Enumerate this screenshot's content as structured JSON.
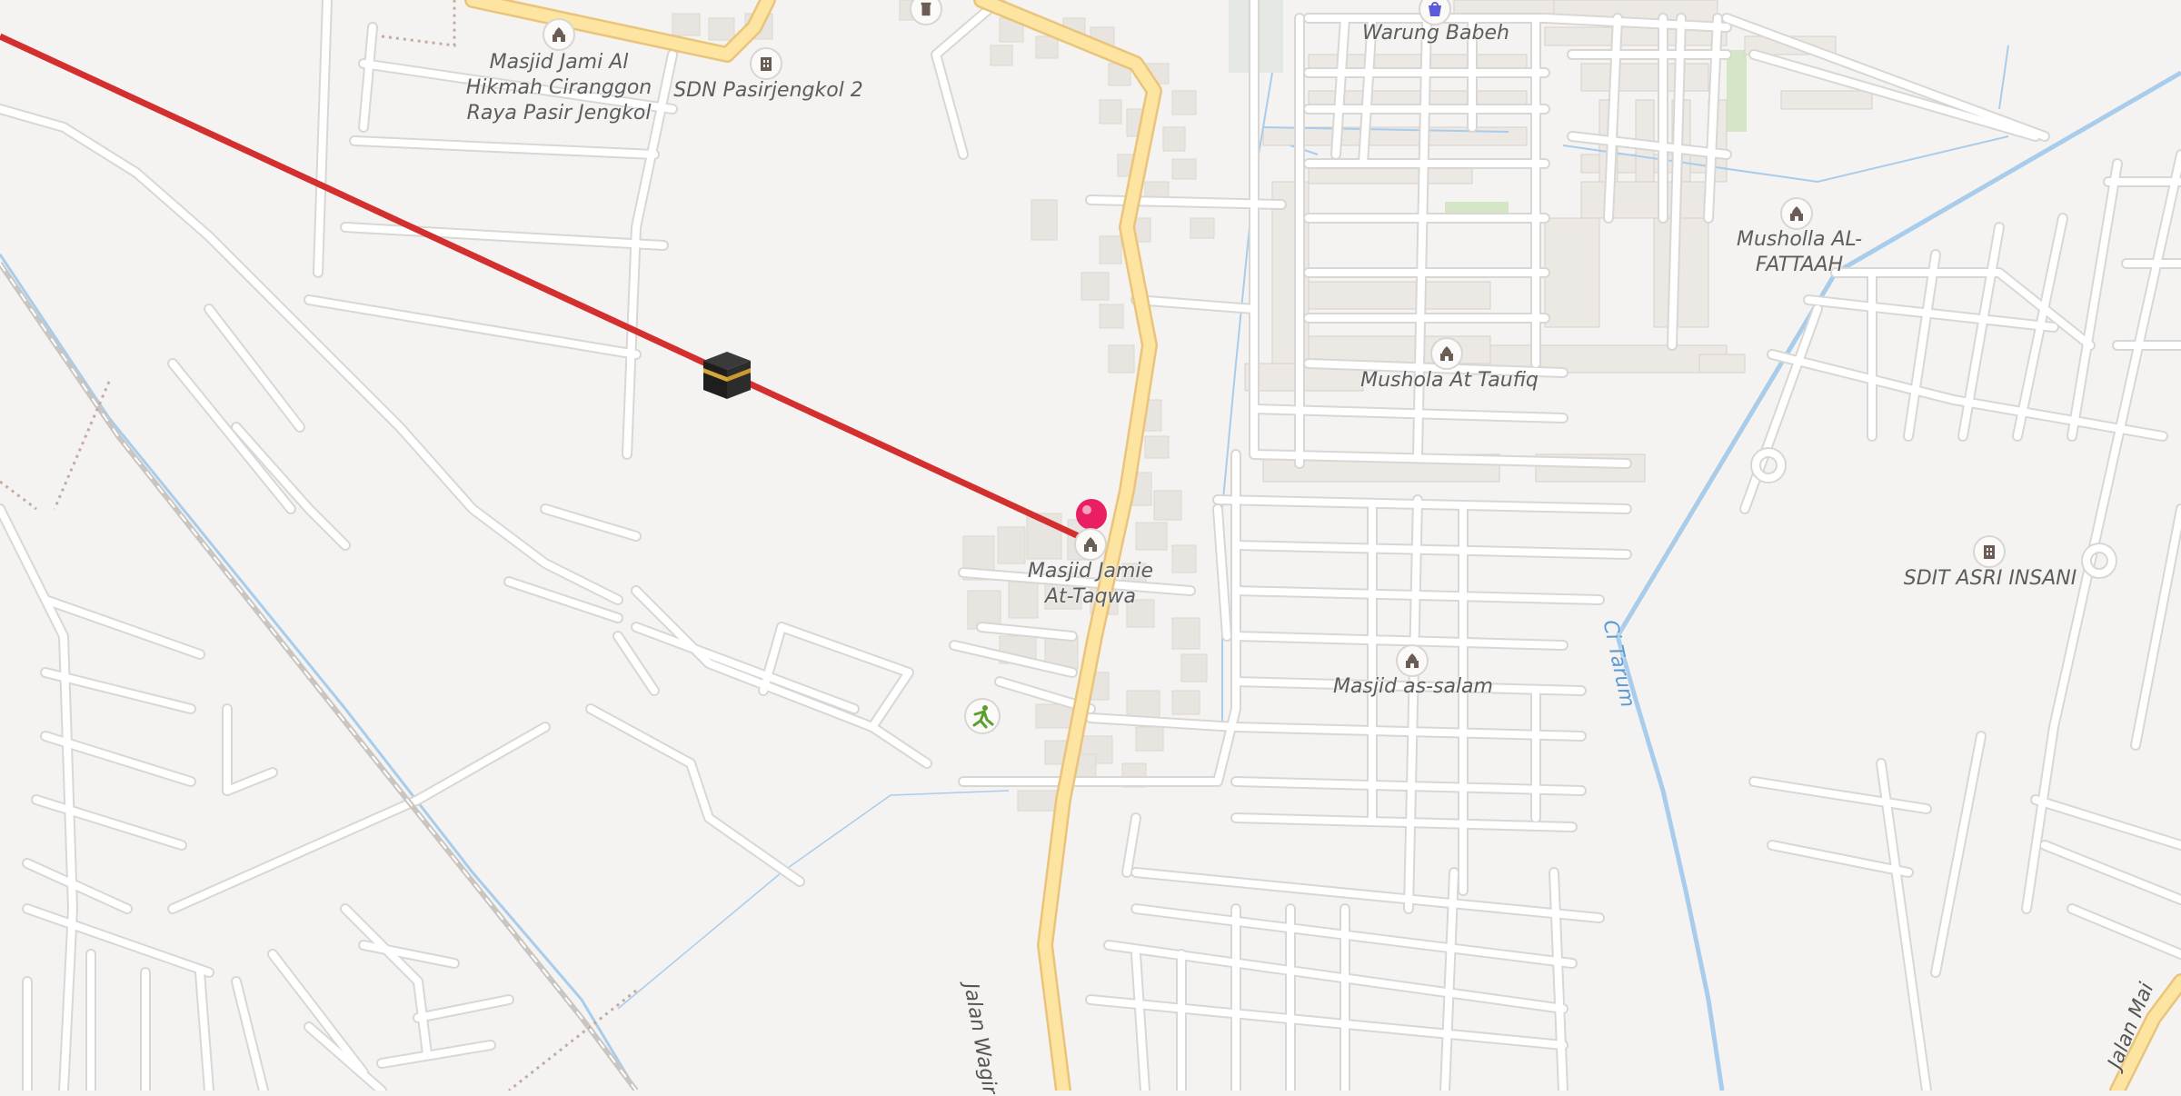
{
  "map": {
    "type": "qibla-direction-map",
    "labels": {
      "masjid_jami_al_hikmah": [
        "Masjid Jami Al",
        "Hikmah Ciranggon",
        "Raya Pasir Jengkol"
      ],
      "sdn_pasirjengkol": "SDN Pasirjengkol 2",
      "warung_babeh": "Warung Babeh",
      "musholla_al_fattaah": [
        "Musholla AL-",
        "FATTAAH"
      ],
      "mushola_at_taufiq": "Mushola At Taufiq",
      "masjid_jamie_at_taqwa": [
        "Masjid Jamie",
        "At-Taqwa"
      ],
      "masjid_as_salam": "Masjid as-salam",
      "sdit_asri_insani": "SDIT ASRI INSANI",
      "jalan_wagir": "Jalan Wagir",
      "jalan_mai": "Jalan Mai",
      "ci_tarum": "Ci Tarum"
    },
    "icons": [
      "mosque-icon",
      "school-icon",
      "kaaba-icon",
      "location-pin-icon",
      "shop-icon",
      "sport-icon"
    ],
    "colors": {
      "background": "#f4f3f1",
      "road": "#ffffff",
      "road_outline": "#d9d7d3",
      "main_road": "#fde4a0",
      "main_road_outline": "#e9c47a",
      "building": "#e8e4df",
      "water": "#a8ccec",
      "qibla_line": "#d32f2f",
      "pin": "#e91e63"
    }
  }
}
